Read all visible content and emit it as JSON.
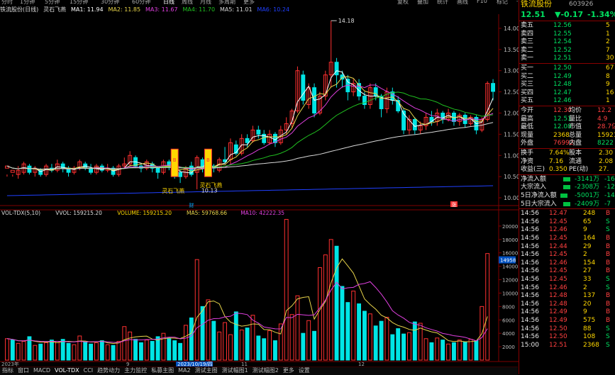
{
  "topbar": {
    "items": [
      "分时",
      "1分钟",
      "5分钟",
      "15分钟",
      "30分钟",
      "60分钟",
      "日线",
      "周线",
      "月线",
      "多周期",
      "更多"
    ],
    "right": [
      "复权",
      "叠加",
      "统计",
      "画线",
      "F10",
      "标记",
      "-"
    ]
  },
  "title": {
    "stock": "铁流股份(日线)",
    "indicator": "灵石飞燕",
    "ma1": "MA1: 11.94",
    "ma2": "MA2: 11.85",
    "ma3": "MA3: 11.67",
    "ma4": "MA4: 11.70",
    "ma5": "MA5: 11.01",
    "ma6": "MA6: 10.24"
  },
  "colors": {
    "up": "#ff3030",
    "down": "#00e5e5",
    "ma1": "#ffffff",
    "ma2": "#e8d44a",
    "ma3": "#e040e0",
    "ma4": "#20c020",
    "ma5": "#d8d8d8",
    "ma6": "#2040ff",
    "axis": "#800000"
  },
  "price_chart": {
    "ylim": [
      9.9,
      14.3
    ],
    "yticks": [
      "14.00",
      "13.50",
      "13.00",
      "12.50",
      "12.00",
      "11.50",
      "11.00",
      "10.50",
      "10.00"
    ],
    "high_label": "14.18",
    "low_label": "10.13",
    "signals": [
      "灵石飞燕",
      "灵石飞燕"
    ],
    "markers": [
      "财",
      "涨"
    ],
    "candles": [
      [
        10.7,
        10.75,
        10.55,
        10.5
      ],
      [
        10.6,
        10.65,
        10.55,
        10.5
      ],
      [
        10.55,
        10.65,
        10.75,
        10.45
      ],
      [
        10.6,
        10.8,
        10.85,
        10.55
      ],
      [
        10.75,
        10.6,
        10.8,
        10.55
      ],
      [
        10.6,
        10.7,
        10.75,
        10.5
      ],
      [
        10.65,
        10.55,
        10.7,
        10.5
      ],
      [
        10.55,
        10.75,
        10.8,
        10.5
      ],
      [
        10.7,
        10.65,
        10.8,
        10.6
      ],
      [
        10.65,
        10.8,
        10.9,
        10.6
      ],
      [
        10.8,
        10.7,
        10.85,
        10.6
      ],
      [
        10.7,
        10.6,
        10.75,
        10.5
      ],
      [
        10.6,
        10.7,
        10.75,
        10.55
      ],
      [
        10.7,
        10.85,
        10.9,
        10.65
      ],
      [
        10.8,
        10.7,
        10.85,
        10.65
      ],
      [
        10.7,
        10.6,
        10.8,
        10.55
      ],
      [
        10.6,
        10.75,
        10.8,
        10.55
      ],
      [
        10.75,
        10.65,
        10.8,
        10.6
      ],
      [
        10.65,
        10.7,
        10.8,
        10.6
      ],
      [
        10.7,
        10.55,
        10.75,
        10.5
      ],
      [
        10.55,
        10.75,
        10.8,
        10.5
      ],
      [
        10.75,
        10.8,
        10.95,
        10.7
      ],
      [
        10.8,
        11.0,
        11.1,
        10.75
      ],
      [
        10.95,
        10.75,
        11.0,
        10.7
      ],
      [
        10.75,
        10.7,
        10.8,
        10.6
      ],
      [
        10.7,
        10.85,
        10.9,
        10.65
      ],
      [
        10.8,
        10.7,
        10.85,
        10.6
      ],
      [
        10.7,
        10.6,
        10.75,
        10.45
      ],
      [
        10.6,
        10.85,
        10.9,
        10.55
      ],
      [
        10.85,
        10.75,
        10.9,
        10.65
      ],
      [
        10.75,
        10.6,
        10.8,
        10.45
      ],
      [
        10.6,
        10.5,
        10.65,
        10.35
      ],
      [
        10.5,
        10.7,
        10.75,
        10.45
      ],
      [
        10.75,
        10.55,
        10.85,
        10.5
      ],
      [
        10.6,
        10.95,
        11.0,
        10.2
      ],
      [
        10.9,
        10.7,
        10.95,
        10.6
      ],
      [
        10.7,
        10.75,
        10.85,
        10.6
      ],
      [
        10.75,
        10.7,
        10.8,
        10.6
      ],
      [
        10.65,
        10.9,
        10.95,
        10.6
      ],
      [
        10.9,
        10.85,
        11.2,
        10.8
      ],
      [
        10.9,
        11.3,
        11.4,
        10.8
      ],
      [
        11.25,
        11.05,
        11.35,
        11.0
      ],
      [
        11.05,
        11.4,
        11.5,
        11.0
      ],
      [
        11.4,
        11.3,
        11.5,
        11.2
      ],
      [
        11.35,
        11.6,
        11.7,
        11.3
      ],
      [
        11.6,
        11.5,
        11.7,
        11.4
      ],
      [
        11.5,
        11.3,
        11.6,
        11.25
      ],
      [
        11.3,
        11.5,
        11.6,
        11.25
      ],
      [
        11.5,
        11.3,
        11.55,
        11.2
      ],
      [
        11.3,
        11.6,
        11.7,
        11.25
      ],
      [
        11.6,
        11.75,
        11.9,
        11.5
      ],
      [
        11.75,
        12.05,
        12.1,
        11.65
      ],
      [
        12.05,
        13.0,
        13.1,
        12.0
      ],
      [
        12.9,
        12.3,
        13.0,
        12.2
      ],
      [
        12.2,
        12.6,
        12.7,
        12.1
      ],
      [
        12.6,
        12.0,
        12.7,
        11.9
      ],
      [
        12.0,
        12.4,
        12.5,
        11.95
      ],
      [
        12.4,
        12.9,
        13.0,
        12.3
      ],
      [
        12.9,
        13.2,
        14.18,
        12.6
      ],
      [
        13.2,
        12.9,
        13.3,
        12.6
      ],
      [
        12.9,
        12.8,
        13.0,
        12.6
      ],
      [
        12.8,
        12.5,
        12.9,
        12.3
      ],
      [
        12.5,
        12.7,
        12.8,
        12.4
      ],
      [
        12.7,
        12.4,
        12.8,
        12.3
      ],
      [
        12.4,
        12.2,
        12.5,
        12.1
      ],
      [
        12.2,
        12.6,
        12.7,
        12.1
      ],
      [
        12.6,
        12.4,
        12.7,
        12.3
      ],
      [
        12.4,
        12.1,
        12.45,
        11.9
      ],
      [
        12.1,
        12.5,
        12.6,
        12.0
      ],
      [
        12.5,
        12.3,
        12.6,
        12.2
      ],
      [
        12.3,
        12.05,
        12.4,
        12.0
      ],
      [
        12.05,
        11.6,
        12.1,
        11.5
      ],
      [
        11.6,
        11.85,
        11.95,
        11.5
      ],
      [
        11.85,
        11.6,
        11.9,
        11.5
      ],
      [
        11.6,
        11.7,
        11.8,
        11.5
      ],
      [
        11.7,
        11.9,
        12.0,
        11.6
      ],
      [
        11.9,
        11.8,
        12.05,
        11.7
      ],
      [
        11.8,
        12.0,
        12.1,
        11.7
      ],
      [
        12.0,
        11.85,
        12.05,
        11.75
      ],
      [
        11.85,
        12.0,
        12.1,
        11.8
      ],
      [
        12.0,
        11.8,
        12.05,
        11.7
      ],
      [
        11.8,
        11.95,
        12.0,
        11.7
      ],
      [
        11.95,
        11.75,
        12.0,
        11.65
      ],
      [
        11.75,
        11.9,
        11.95,
        11.7
      ],
      [
        11.9,
        11.6,
        11.95,
        11.5
      ],
      [
        11.6,
        11.85,
        11.9,
        11.55
      ],
      [
        11.85,
        12.7,
        12.75,
        11.8
      ],
      [
        12.7,
        12.51,
        12.8,
        12.3
      ]
    ]
  },
  "volume_chart": {
    "header": {
      "name": "VOL-TDX(5,10)",
      "vvol": "VVOL: 159215.20",
      "volume": "VOLUME: 159215.20",
      "ma5": "MA5: 59768.66",
      "ma10": "MA10: 42222.35"
    },
    "ylim": [
      0,
      22000
    ],
    "yticks": [
      "20000",
      "18000",
      "16000",
      "14000",
      "12000",
      "10000",
      "8000",
      "6000",
      "4000",
      "2000"
    ],
    "marker": "14958",
    "values": [
      3200,
      3000,
      2500,
      2800,
      3500,
      2200,
      2400,
      2600,
      3000,
      2800,
      3100,
      2500,
      2300,
      3600,
      2700,
      2400,
      2600,
      2900,
      2300,
      2200,
      2800,
      5000,
      4200,
      3100,
      2600,
      3000,
      2800,
      3500,
      4000,
      3200,
      2900,
      2500,
      5200,
      6300,
      15000,
      8000,
      9000,
      5800,
      4200,
      5600,
      3800,
      7200,
      4500,
      4800,
      6700,
      3600,
      3200,
      4400,
      2900,
      5400,
      21000,
      6800,
      9600,
      4000,
      5900,
      4300,
      13800,
      15700,
      18000,
      17000,
      11000,
      8600,
      10300,
      8400,
      7300,
      6900,
      5100,
      5800,
      6400,
      3800,
      4700,
      3900,
      4100,
      5700,
      5500,
      3200,
      2600,
      3300,
      3000,
      2400,
      2600,
      3000,
      2700,
      3100,
      2900,
      8000,
      15900
    ],
    "up": [
      1,
      0,
      1,
      1,
      0,
      1,
      0,
      1,
      0,
      1,
      0,
      0,
      1,
      1,
      0,
      0,
      1,
      0,
      1,
      0,
      1,
      1,
      1,
      0,
      0,
      1,
      0,
      0,
      1,
      0,
      0,
      0,
      1,
      0,
      1,
      0,
      1,
      0,
      1,
      1,
      1,
      0,
      1,
      0,
      1,
      0,
      0,
      1,
      0,
      1,
      1,
      1,
      1,
      0,
      1,
      0,
      1,
      1,
      1,
      0,
      0,
      0,
      1,
      0,
      0,
      1,
      0,
      0,
      1,
      0,
      0,
      0,
      1,
      0,
      1,
      1,
      0,
      1,
      0,
      1,
      0,
      1,
      0,
      1,
      0,
      1,
      1
    ]
  },
  "xaxis": {
    "labels": [
      "2023年",
      "9",
      "2023/10/19/四",
      "11",
      "12"
    ]
  },
  "statusbar": [
    "指标",
    "窗口",
    "MACD",
    "VOL-TDX",
    "CCI",
    "趋势动力",
    "主力监控",
    "私募主图",
    "MA2",
    "测试主图",
    "测试幅图1",
    "测试幅图2",
    "更多",
    "设置"
  ],
  "quote": {
    "name": "铁流股份",
    "code": "603926",
    "price": "12.51",
    "change": "▼-0.17",
    "pct": "-1.34%",
    "asks": [
      [
        "卖五",
        "12.56",
        "5"
      ],
      [
        "卖四",
        "12.55",
        "1"
      ],
      [
        "卖三",
        "12.54",
        "2"
      ],
      [
        "卖二",
        "12.52",
        "7"
      ],
      [
        "卖一",
        "12.51",
        "30"
      ]
    ],
    "bids": [
      [
        "买一",
        "12.50",
        "67"
      ],
      [
        "买二",
        "12.49",
        "8"
      ],
      [
        "买三",
        "12.48",
        "9"
      ],
      [
        "买四",
        "12.47",
        "16"
      ],
      [
        "买五",
        "12.46",
        "1"
      ]
    ],
    "stats": [
      [
        "今开",
        "12.30",
        "均价",
        "12.2"
      ],
      [
        "最高",
        "12.51",
        "量比",
        "4.9"
      ],
      [
        "最低",
        "12.08",
        "市值",
        "28.7亿"
      ],
      [
        "现量",
        "2368",
        "总量",
        "15921"
      ],
      [
        "外盘",
        "76992",
        "内盘",
        "8222"
      ]
    ],
    "stats2": [
      [
        "换手",
        "7.64%",
        "股本",
        "2.30"
      ],
      [
        "净资",
        "7.16",
        "流通",
        "2.08"
      ],
      [
        "收益(三)",
        "0.350",
        "PE(动)",
        "27."
      ]
    ],
    "flows": [
      [
        "净流入额",
        "-3141万",
        "-16"
      ],
      [
        "大宗流入",
        "-2308万",
        "-12"
      ],
      [
        "5日净流入额",
        "-5001万",
        "-14"
      ],
      [
        "5日大宗流入",
        "-2409万",
        "-7"
      ]
    ],
    "ticks": [
      [
        "14:56",
        "12.47",
        "248",
        "B"
      ],
      [
        "14:56",
        "12.45",
        "65",
        "S"
      ],
      [
        "14:56",
        "12.46",
        "9",
        "S"
      ],
      [
        "14:56",
        "12.45",
        "164",
        "B"
      ],
      [
        "14:56",
        "12.44",
        "29",
        "B"
      ],
      [
        "14:56",
        "12.45",
        "2",
        "B"
      ],
      [
        "14:56",
        "12.46",
        "154",
        "B"
      ],
      [
        "14:56",
        "12.45",
        "27",
        "B"
      ],
      [
        "14:56",
        "12.45",
        "33",
        "S"
      ],
      [
        "14:56",
        "12.46",
        "2",
        "S"
      ],
      [
        "14:56",
        "12.48",
        "137",
        "B"
      ],
      [
        "14:56",
        "12.48",
        "20",
        "B"
      ],
      [
        "14:56",
        "12.49",
        "9",
        "B"
      ],
      [
        "14:56",
        "12.49",
        "575",
        "B"
      ],
      [
        "14:56",
        "12.50",
        "88",
        "S"
      ],
      [
        "14:56",
        "12.50",
        "108",
        "S"
      ],
      [
        "15:00",
        "12.51",
        "2368",
        "S"
      ]
    ]
  }
}
